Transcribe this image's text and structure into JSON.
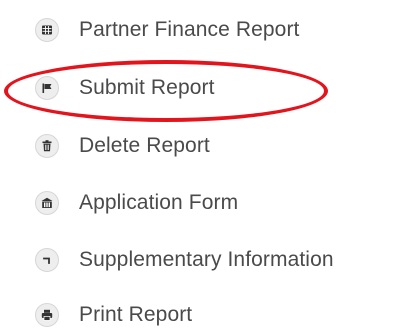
{
  "menu": {
    "items": [
      {
        "label": "Partner Finance Report",
        "icon": "table-icon"
      },
      {
        "label": "Submit Report",
        "icon": "flag-icon"
      },
      {
        "label": "Delete Report",
        "icon": "trash-icon"
      },
      {
        "label": "Application Form",
        "icon": "bank-icon"
      },
      {
        "label": "Supplementary Information",
        "icon": "corner-icon"
      },
      {
        "label": "Print Report",
        "icon": "print-icon"
      }
    ]
  },
  "colors": {
    "text": "#4a4a4a",
    "icon_bg": "#eeeeee",
    "icon_glyph": "#333333",
    "highlight": "#e4141d"
  }
}
